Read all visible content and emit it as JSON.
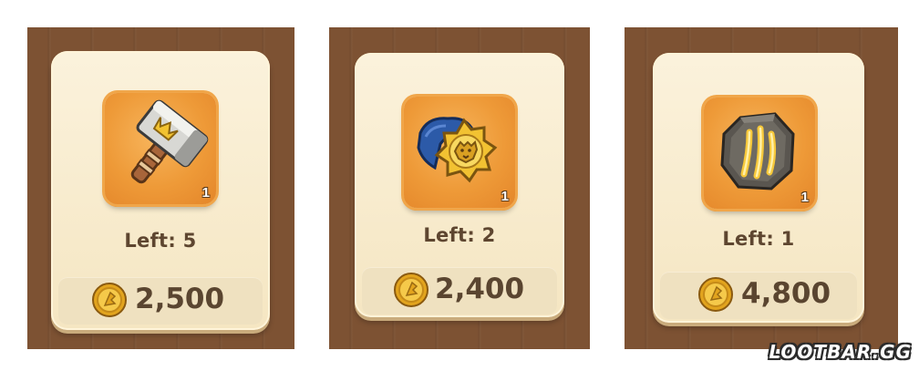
{
  "shop_items": [
    {
      "icon": "hammer-icon",
      "quantity": "1",
      "left_label": "Left: 5",
      "price": "2,500"
    },
    {
      "icon": "lion-emblem-icon",
      "quantity": "1",
      "left_label": "Left: 2",
      "price": "2,400"
    },
    {
      "icon": "rune-stone-icon",
      "quantity": "1",
      "left_label": "Left: 1",
      "price": "4,800"
    }
  ],
  "currency_icon": "gold-coin-icon",
  "watermark": "LOOTBAR.GG",
  "colors": {
    "wood": "#7d5233",
    "card": "#f8ecd0",
    "tile": "#ee9a38",
    "text": "#5a4530"
  }
}
